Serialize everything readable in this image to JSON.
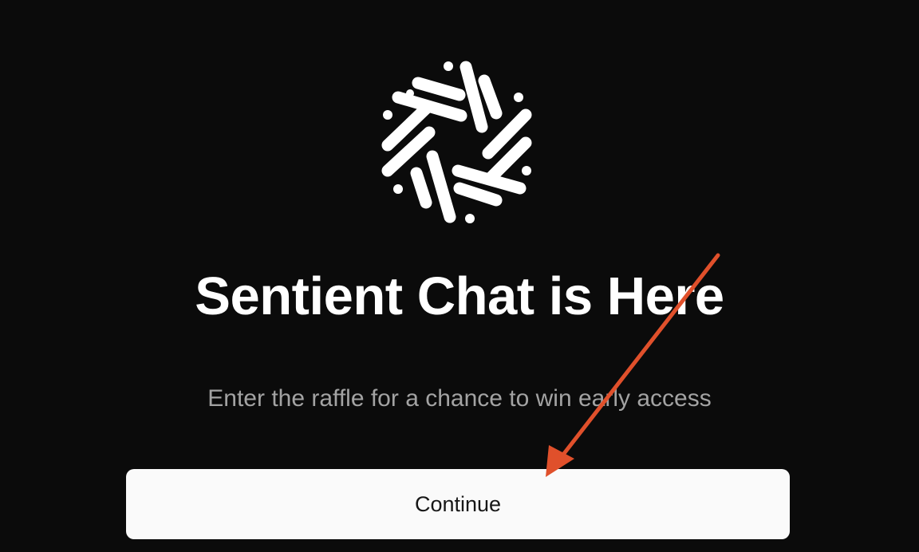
{
  "logo": {
    "icon": "sentient-logo-icon"
  },
  "hero": {
    "title": "Sentient Chat is Here",
    "subtitle": "Enter the raffle for a chance to win early access"
  },
  "actions": {
    "continue_label": "Continue"
  },
  "annotation": {
    "icon": "arrow-annotation-icon",
    "color": "#e0502b"
  },
  "colors": {
    "background": "#0b0b0b",
    "text_primary": "#ffffff",
    "text_secondary": "#a3a3a3",
    "button_bg": "#fafafa",
    "button_text": "#171717"
  }
}
